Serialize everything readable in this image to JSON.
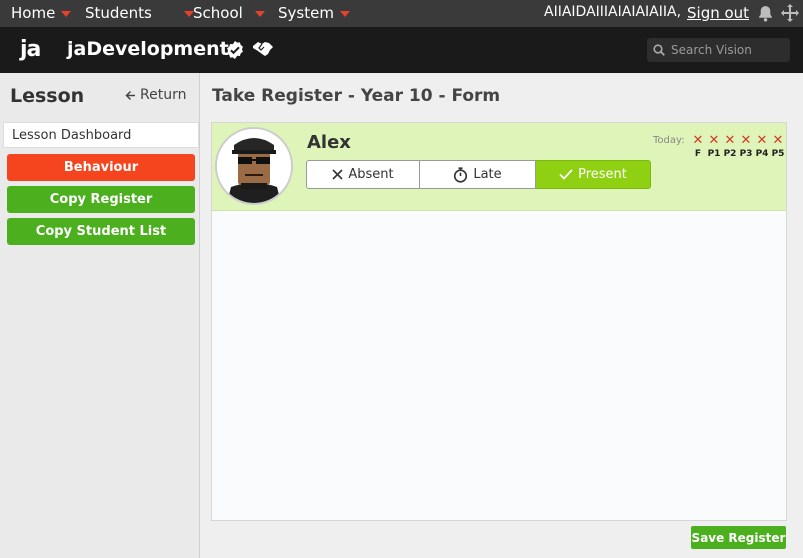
{
  "topnav": {
    "items": [
      {
        "label": "Home"
      },
      {
        "label": "Students"
      },
      {
        "label": "School"
      },
      {
        "label": "System"
      }
    ],
    "user": "AIIAIDAIIIAIAIAIAIIA,",
    "signout": "Sign out",
    "bell_icon": "bell-icon",
    "move_icon": "move-icon",
    "caret_color": "#e8412a"
  },
  "brand": {
    "logo": "ja",
    "appname": "jaDevelopment",
    "badge_icon": "verified-badge-icon",
    "hands_icon": "handshake-icon",
    "search_placeholder": "Search Vision"
  },
  "sidebar": {
    "title": "Lesson",
    "return_label": "Return",
    "dashboard_label": "Lesson Dashboard",
    "buttons": [
      {
        "label": "Behaviour",
        "color": "#f5451e"
      },
      {
        "label": "Copy Register",
        "color": "#4caf1e"
      },
      {
        "label": "Copy Student List",
        "color": "#4caf1e"
      }
    ]
  },
  "main": {
    "title": "Take Register - Year 10 - Form",
    "student": {
      "name": "Alex",
      "options": [
        {
          "label": "Absent",
          "icon": "close-icon"
        },
        {
          "label": "Late",
          "icon": "stopwatch-icon"
        },
        {
          "label": "Present",
          "icon": "check-icon",
          "selected": true
        }
      ],
      "today_label": "Today:",
      "periods": [
        {
          "label": "F",
          "mark": "✕"
        },
        {
          "label": "P1",
          "mark": "✕"
        },
        {
          "label": "P2",
          "mark": "✕"
        },
        {
          "label": "P3",
          "mark": "✕"
        },
        {
          "label": "P4",
          "mark": "✕"
        },
        {
          "label": "P5",
          "mark": "✕"
        }
      ]
    },
    "save_label": "Save Register"
  }
}
